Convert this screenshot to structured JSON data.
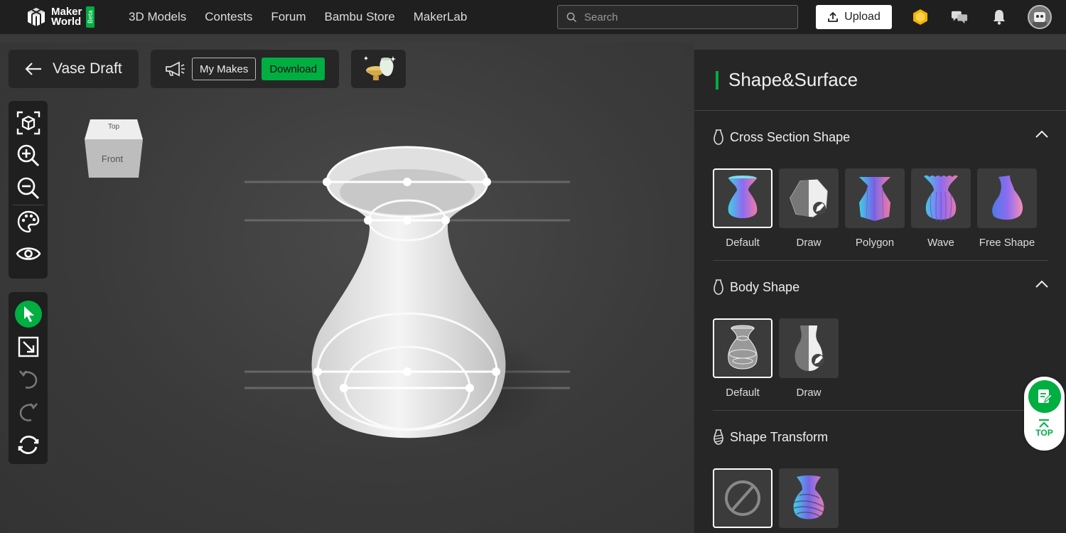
{
  "nav": {
    "logo_line1": "Maker",
    "logo_line2": "World",
    "logo_badge": "Beta",
    "links": [
      "3D Models",
      "Contests",
      "Forum",
      "Bambu Store",
      "MakerLab"
    ],
    "search_placeholder": "Search",
    "upload_label": "Upload"
  },
  "editor": {
    "back_title": "Vase Draft",
    "my_makes_label": "My Makes",
    "download_label": "Download",
    "viewcube_top": "Top",
    "viewcube_front": "Front"
  },
  "panel": {
    "title": "Shape&Surface",
    "cross_section": {
      "title": "Cross Section Shape",
      "options": [
        "Default",
        "Draw",
        "Polygon",
        "Wave",
        "Free Shape"
      ],
      "selected": "Default"
    },
    "body_shape": {
      "title": "Body Shape",
      "options": [
        "Default",
        "Draw"
      ],
      "selected": "Default"
    },
    "shape_transform": {
      "title": "Shape Transform",
      "selected": "none"
    }
  },
  "float": {
    "top_label": "TOP"
  },
  "colors": {
    "accent": "#00ae42",
    "panel_bg": "#262626",
    "nav_bg": "#1f1f1f"
  }
}
